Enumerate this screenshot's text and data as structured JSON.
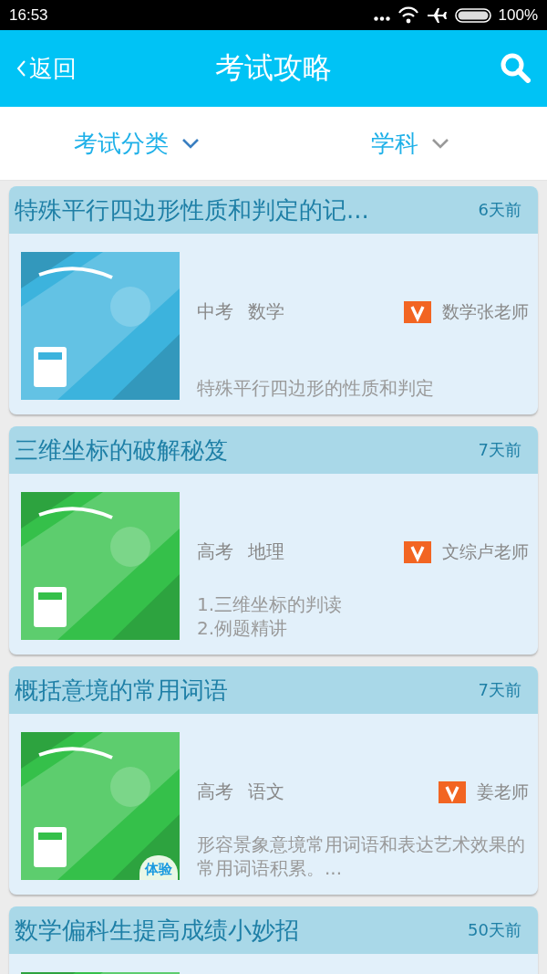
{
  "status_bar": {
    "time": "16:53",
    "battery": "100%"
  },
  "header": {
    "back": "返回",
    "title": "考试攻略"
  },
  "filters": [
    {
      "label": "考试分类",
      "selected": true
    },
    {
      "label": "学科",
      "selected": false
    }
  ],
  "articles": [
    {
      "title": "特殊平行四边形性质和判定的记...",
      "time": "6天前",
      "color": "#3cb3dd",
      "exam": "中考",
      "subject": "数学",
      "teacher": "数学张老师",
      "summary": "特殊平行四边形的性质和判定"
    },
    {
      "title": "三维坐标的破解秘笈",
      "time": "7天前",
      "color": "#35c04a",
      "exam": "高考",
      "subject": "地理",
      "teacher": "文综卢老师",
      "summary": "1.三维坐标的判读\n2.例题精讲"
    },
    {
      "title": "概括意境的常用词语",
      "time": "7天前",
      "color": "#35c04a",
      "exam": "高考",
      "subject": "语文",
      "teacher": "姜老师",
      "summary": "形容景象意境常用词语和表达艺术效果的常用词语积累。...",
      "badge": "体验"
    },
    {
      "title": "数学偏科生提高成绩小妙招",
      "time": "50天前",
      "color": "#35c04a"
    }
  ]
}
